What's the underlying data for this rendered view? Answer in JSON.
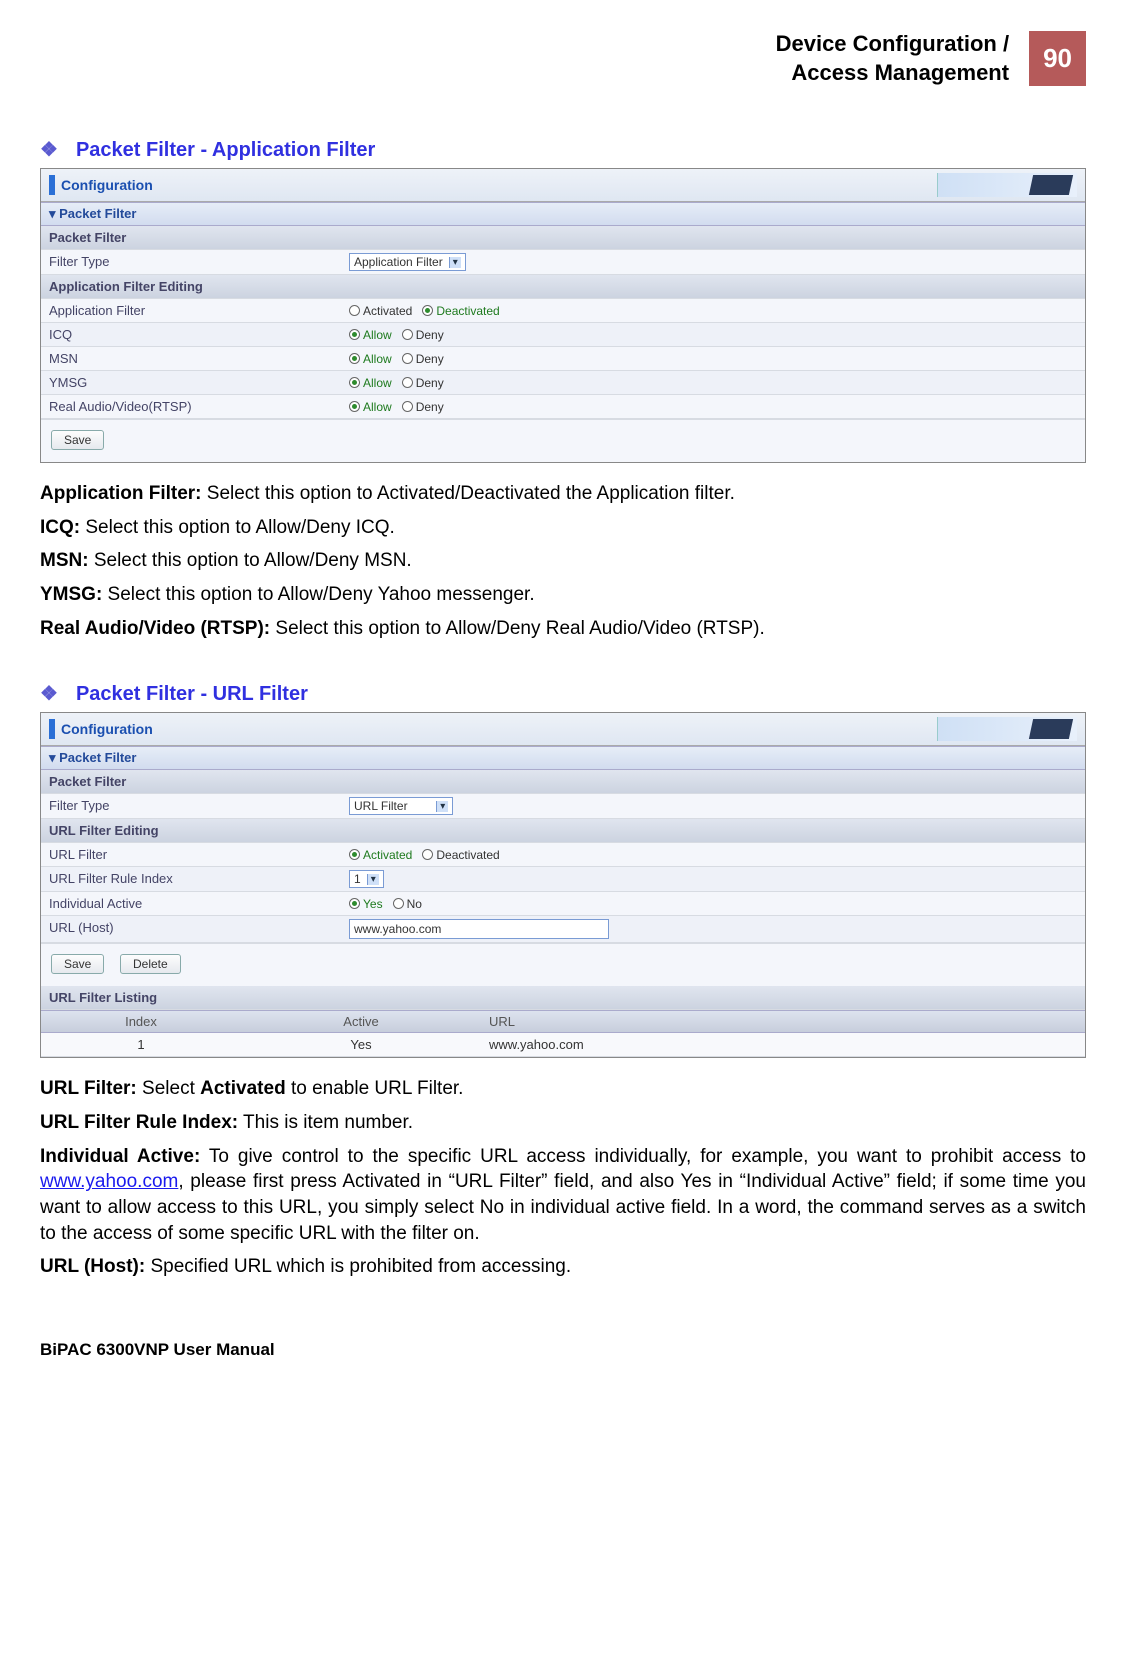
{
  "header": {
    "title_line1": "Device Configuration /",
    "title_line2": "Access Management",
    "page_number": "90"
  },
  "sectionA": {
    "heading": "Packet Filter - Application Filter",
    "conf_title": "Configuration",
    "band1": "Packet Filter",
    "row_packet_filter": "Packet Filter",
    "row_filter_type_label": "Filter Type",
    "row_filter_type_value": "Application Filter",
    "band2": "Application Filter Editing",
    "row_app_filter_label": "Application Filter",
    "opt_activated": "Activated",
    "opt_deactivated": "Deactivated",
    "row_icq": "ICQ",
    "row_msn": "MSN",
    "row_ymsg": "YMSG",
    "row_rtsp": "Real Audio/Video(RTSP)",
    "opt_allow": "Allow",
    "opt_deny": "Deny",
    "btn_save": "Save"
  },
  "descA": {
    "p1_b": "Application Filter:",
    "p1_t": " Select this option to Activated/Deactivated the Application filter.",
    "p2_b": "ICQ:",
    "p2_t": " Select this option to Allow/Deny ICQ.",
    "p3_b": "MSN:",
    "p3_t": " Select this option to Allow/Deny MSN.",
    "p4_b": "YMSG:",
    "p4_t": " Select this option to Allow/Deny Yahoo messenger.",
    "p5_b": "Real Audio/Video (RTSP):",
    "p5_t": " Select this option to Allow/Deny Real Audio/Video (RTSP)."
  },
  "sectionB": {
    "heading": "Packet Filter - URL Filter",
    "conf_title": "Configuration",
    "band1": "Packet Filter",
    "row_packet_filter": "Packet Filter",
    "row_filter_type_label": "Filter Type",
    "row_filter_type_value": "URL Filter",
    "band2": "URL Filter Editing",
    "row_url_filter_label": "URL Filter",
    "opt_activated": "Activated",
    "opt_deactivated": "Deactivated",
    "row_rule_index_label": "URL Filter Rule Index",
    "row_rule_index_value": "1",
    "row_individual_label": "Individual Active",
    "opt_yes": "Yes",
    "opt_no": "No",
    "row_url_host_label": "URL (Host)",
    "row_url_host_value": "www.yahoo.com",
    "btn_save": "Save",
    "btn_delete": "Delete",
    "band3": "URL Filter Listing",
    "col_index": "Index",
    "col_active": "Active",
    "col_url": "URL",
    "list_index": "1",
    "list_active": "Yes",
    "list_url": "www.yahoo.com"
  },
  "descB": {
    "p1_b": "URL Filter:",
    "p1_t1": " Select ",
    "p1_bold2": "Activated",
    "p1_t2": " to enable URL Filter.",
    "p2_b": "URL Filter Rule Index:",
    "p2_t": " This is item number.",
    "p3_b": "Individual Active:",
    "p3_t1": " To give control to the specific URL access individually, for example, you want to prohibit access to ",
    "p3_link": "www.yahoo.com",
    "p3_t2": ", please first press Activated in “URL Filter” field, and also Yes in “Individual Active” field; if some time you want to allow access to this URL, you simply select No in individual active field. In a word, the command serves as a switch to the access of some specific URL with the filter on.",
    "p4_b": "URL (Host):",
    "p4_t": " Specified URL which is prohibited from accessing."
  },
  "footer": "BiPAC 6300VNP User Manual"
}
